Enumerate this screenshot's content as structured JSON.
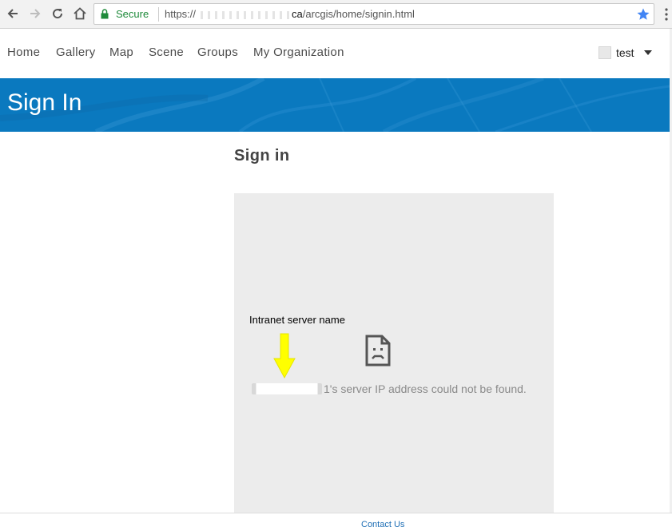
{
  "browser": {
    "secure_label": "Secure",
    "url_scheme": "https://",
    "url_host_suffix": "ca",
    "url_path": "/arcgis/home/signin.html"
  },
  "nav": {
    "items": [
      {
        "label": "Home"
      },
      {
        "label": "Gallery"
      },
      {
        "label": "Map"
      },
      {
        "label": "Scene"
      },
      {
        "label": "Groups"
      },
      {
        "label": "My Organization"
      }
    ],
    "user": {
      "name": "test"
    }
  },
  "banner": {
    "title": "Sign In"
  },
  "content": {
    "heading": "Sign in",
    "annotation": "Intranet server name",
    "error_suffix": "1's server IP address could not be found."
  },
  "footer": {
    "contact_label": "Contact Us"
  },
  "colors": {
    "banner": "#0a79bf",
    "secure": "#1e8a3a",
    "arrow": "#ffff00",
    "link": "#1f6fb5"
  },
  "icons": [
    "back-icon",
    "forward-icon",
    "reload-icon",
    "home-icon",
    "lock-icon",
    "star-icon",
    "kebab-menu-icon",
    "avatar",
    "caret-down-icon",
    "arrow-down-icon",
    "sad-document-icon"
  ]
}
